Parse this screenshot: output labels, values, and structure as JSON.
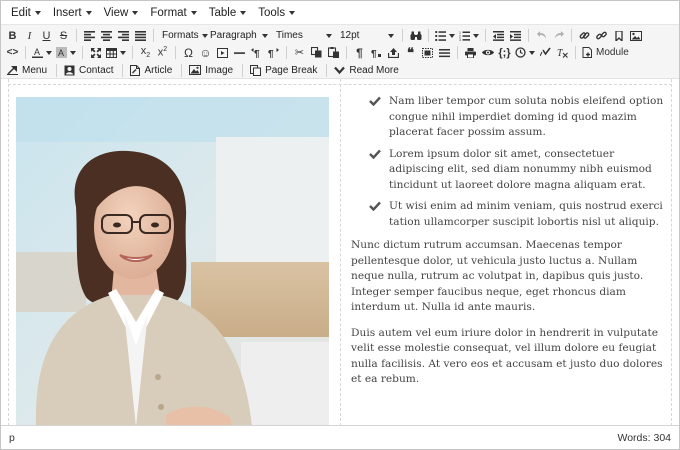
{
  "menubar": {
    "items": [
      "Edit",
      "Insert",
      "View",
      "Format",
      "Table",
      "Tools"
    ]
  },
  "toolbar": {
    "formats_label": "Formats",
    "block_format": "Paragraph",
    "font_family": "Times",
    "font_size": "12pt",
    "module_label": "Module",
    "row3": {
      "menu_label": "Menu",
      "contact_label": "Contact",
      "article_label": "Article",
      "image_label": "Image",
      "pagebreak_label": "Page Break",
      "readmore_label": "Read More"
    }
  },
  "content": {
    "checklist": [
      "Nam liber tempor cum soluta nobis eleifend option congue nihil imperdiet doming id quod mazim placerat facer possim assum.",
      "Lorem ipsum dolor sit amet, consectetuer adipiscing elit, sed diam nonummy nibh euismod tincidunt ut laoreet dolore magna aliquam erat.",
      "Ut wisi enim ad minim veniam, quis nostrud exerci tation ullamcorper suscipit lobortis nisl ut aliquip."
    ],
    "paragraphs": [
      "Nunc dictum rutrum accumsan. Maecenas tempor pellentesque dolor, ut vehicula justo luctus a. Nullam neque nulla, rutrum ac volutpat in, dapibus quis justo. Integer semper faucibus neque, eget rhoncus diam interdum ut. Nulla id ante mauris.",
      "Duis autem vel eum iriure dolor in hendrerit in vulputate velit esse molestie consequat, vel illum dolore eu feugiat nulla facilisis. At vero eos et accusam et justo duo dolores et ea rebum."
    ]
  },
  "statusbar": {
    "path": "p",
    "words": "Words: 304"
  },
  "colors": {
    "toolbar_bg": "#f5f5f5",
    "check_color": "#555555",
    "text_color": "#444444"
  }
}
